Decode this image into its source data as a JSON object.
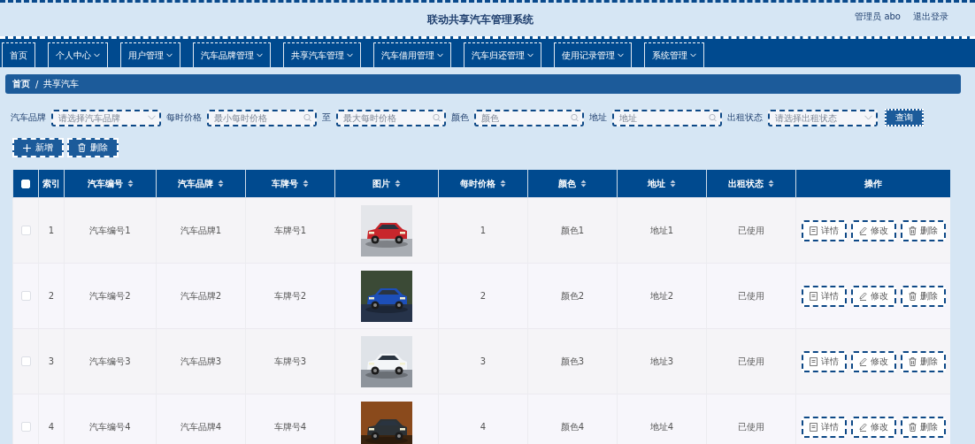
{
  "header": {
    "title": "联动共享汽车管理系统",
    "user": "管理员 abo",
    "logout": "退出登录"
  },
  "nav": [
    {
      "label": "首页",
      "has_menu": false
    },
    {
      "label": "个人中心",
      "has_menu": true
    },
    {
      "label": "用户管理",
      "has_menu": true
    },
    {
      "label": "汽车品牌管理",
      "has_menu": true
    },
    {
      "label": "共享汽车管理",
      "has_menu": true
    },
    {
      "label": "汽车借用管理",
      "has_menu": true
    },
    {
      "label": "汽车归还管理",
      "has_menu": true
    },
    {
      "label": "使用记录管理",
      "has_menu": true
    },
    {
      "label": "系统管理",
      "has_menu": true
    }
  ],
  "breadcrumb": {
    "items": [
      "首页",
      "共享汽车"
    ],
    "separator": "/"
  },
  "filters": [
    {
      "label": "汽车品牌",
      "kind": "select",
      "placeholder": "请选择汽车品牌"
    },
    {
      "label": "每时价格",
      "kind": "search",
      "placeholder": "最小每时价格"
    },
    {
      "label": "至",
      "kind": "search",
      "placeholder": "最大每时价格"
    },
    {
      "label": "颜色",
      "kind": "search",
      "placeholder": "颜色"
    },
    {
      "label": "地址",
      "kind": "search",
      "placeholder": "地址"
    },
    {
      "label": "出租状态",
      "kind": "select",
      "placeholder": "请选择出租状态"
    }
  ],
  "search_button": "查询",
  "toolbar": [
    {
      "label": "新增",
      "kind": "add"
    },
    {
      "label": "删除",
      "kind": "delete"
    }
  ],
  "table": {
    "header_checked": false,
    "columns": [
      {
        "label": "索引",
        "sortable": false
      },
      {
        "label": "汽车编号",
        "sortable": true
      },
      {
        "label": "汽车品牌",
        "sortable": true
      },
      {
        "label": "车牌号",
        "sortable": true
      },
      {
        "label": "图片",
        "sortable": true
      },
      {
        "label": "每时价格",
        "sortable": true
      },
      {
        "label": "颜色",
        "sortable": true
      },
      {
        "label": "地址",
        "sortable": true
      },
      {
        "label": "出租状态",
        "sortable": true
      },
      {
        "label": "操作",
        "sortable": false
      }
    ],
    "rows": [
      {
        "checked": false,
        "cells": [
          "1",
          "汽车编号1",
          "汽车品牌1",
          "车牌号1",
          {
            "kind": "picture"
          },
          "1",
          "颜色1",
          "地址1",
          "已使用"
        ],
        "actions": [
          {
            "label": "详情",
            "kind": "detail"
          },
          {
            "label": "修改",
            "kind": "edit"
          },
          {
            "label": "删除",
            "kind": "delete"
          }
        ]
      },
      {
        "checked": false,
        "cells": [
          "2",
          "汽车编号2",
          "汽车品牌2",
          "车牌号2",
          {
            "kind": "picture"
          },
          "2",
          "颜色2",
          "地址2",
          "已使用"
        ],
        "actions": [
          {
            "label": "详情",
            "kind": "detail"
          },
          {
            "label": "修改",
            "kind": "edit"
          },
          {
            "label": "删除",
            "kind": "delete"
          }
        ]
      },
      {
        "checked": false,
        "cells": [
          "3",
          "汽车编号3",
          "汽车品牌3",
          "车牌号3",
          {
            "kind": "picture"
          },
          "3",
          "颜色3",
          "地址3",
          "已使用"
        ],
        "actions": [
          {
            "label": "详情",
            "kind": "detail"
          },
          {
            "label": "修改",
            "kind": "edit"
          },
          {
            "label": "删除",
            "kind": "delete"
          }
        ]
      },
      {
        "checked": false,
        "cells": [
          "4",
          "汽车编号4",
          "汽车品牌4",
          "车牌号4",
          {
            "kind": "picture"
          },
          "4",
          "颜色4",
          "地址4",
          "已使用"
        ],
        "actions": [
          {
            "label": "详情",
            "kind": "detail"
          },
          {
            "label": "修改",
            "kind": "edit"
          },
          {
            "label": "删除",
            "kind": "delete"
          }
        ]
      }
    ]
  }
}
